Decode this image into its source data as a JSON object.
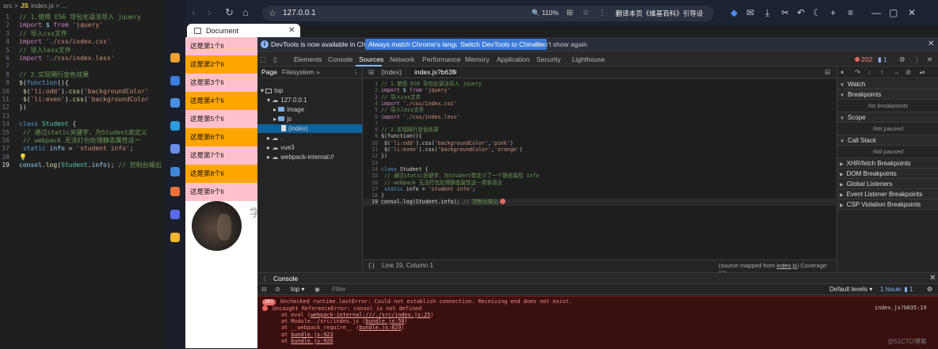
{
  "editor": {
    "breadcrumb": [
      "src",
      ">",
      "JS",
      "index.js",
      ">",
      "..."
    ],
    "lines": [
      {
        "n": "1",
        "parts": [
          [
            "com",
            "// 1.使用 ES6 导包化语法导入 jquery"
          ]
        ]
      },
      {
        "n": "2",
        "parts": [
          [
            "kw",
            "import "
          ],
          [
            "var",
            "$ "
          ],
          [
            "kw",
            "from "
          ],
          [
            "str",
            "'jquery'"
          ]
        ]
      },
      {
        "n": "3",
        "parts": [
          [
            "com",
            "// 导入css文件"
          ]
        ]
      },
      {
        "n": "4",
        "parts": [
          [
            "kw",
            "import "
          ],
          [
            "str",
            "'./css/index.css'"
          ]
        ]
      },
      {
        "n": "5",
        "parts": [
          [
            "com",
            "// 导入less文件"
          ]
        ]
      },
      {
        "n": "6",
        "parts": [
          [
            "kw",
            "import "
          ],
          [
            "str",
            "'./css/index.less'"
          ]
        ]
      },
      {
        "n": "7",
        "parts": []
      },
      {
        "n": "8",
        "parts": [
          [
            "com",
            "// 2.实现隔行变色效果"
          ]
        ]
      },
      {
        "n": "9",
        "parts": [
          [
            "fn",
            "$"
          ],
          [
            "txt",
            "("
          ],
          [
            "bl",
            "function"
          ],
          [
            "txt",
            "(){"
          ]
        ]
      },
      {
        "n": "10",
        "parts": [
          [
            "txt",
            "    "
          ],
          [
            "fn",
            "$"
          ],
          [
            "txt",
            "("
          ],
          [
            "str",
            "'li:odd'"
          ],
          [
            "txt",
            ")."
          ],
          [
            "fn",
            "css"
          ],
          [
            "txt",
            "("
          ],
          [
            "str",
            "'backgroundColor'"
          ]
        ]
      },
      {
        "n": "11",
        "parts": [
          [
            "txt",
            "    "
          ],
          [
            "fn",
            "$"
          ],
          [
            "txt",
            "("
          ],
          [
            "str",
            "'li:even'"
          ],
          [
            "txt",
            ")."
          ],
          [
            "fn",
            "css"
          ],
          [
            "txt",
            "("
          ],
          [
            "str",
            "'backgroundColor"
          ]
        ]
      },
      {
        "n": "12",
        "parts": [
          [
            "txt",
            "})"
          ]
        ]
      },
      {
        "n": "13",
        "parts": []
      },
      {
        "n": "14",
        "parts": [
          [
            "bl",
            "class "
          ],
          [
            "cls",
            "Student "
          ],
          [
            "txt",
            "{"
          ]
        ]
      },
      {
        "n": "15",
        "parts": [
          [
            "com",
            "    // 通过static关键字，为Student类定义"
          ]
        ]
      },
      {
        "n": "16",
        "parts": [
          [
            "com",
            "    // webpack 无法打包处理静态属性这一"
          ]
        ]
      },
      {
        "n": "17",
        "parts": [
          [
            "bl",
            "    static "
          ],
          [
            "var",
            "info "
          ],
          [
            "txt",
            "= "
          ],
          [
            "str",
            "'student info'"
          ],
          [
            "txt",
            ";"
          ]
        ]
      },
      {
        "n": "18",
        "parts": [
          [
            "txt",
            "💡"
          ]
        ]
      },
      {
        "n": "19",
        "parts": [
          [
            "var",
            "consol"
          ],
          [
            "txt",
            "."
          ],
          [
            "fn",
            "log"
          ],
          [
            "txt",
            "("
          ],
          [
            "cls",
            "Student"
          ],
          [
            "txt",
            "."
          ],
          [
            "var",
            "info"
          ],
          [
            "txt",
            "); "
          ],
          [
            "com",
            "// 控制台输出"
          ]
        ]
      }
    ]
  },
  "browser": {
    "url": "127.0.0.1",
    "zoom": "110%",
    "translate_label": "翻译本页《维基百科》引导设",
    "tab_title": "Document"
  },
  "page": {
    "list_items": [
      "这是第1个li",
      "这是第2个li",
      "这是第3个li",
      "这是第4个li",
      "这是第5个li",
      "这是第6个li",
      "这是第7个li",
      "这是第8个li",
      "这是第9个li"
    ],
    "odd_color": "#ffc0cb",
    "even_color": "#ffa500",
    "side_text": "学"
  },
  "devtools": {
    "info_message": "DevTools is now available in Chinese!",
    "btn_match": "Always match Chrome's language",
    "btn_switch": "Switch DevTools to Chinese",
    "dont_show": "Don't show again",
    "tabs": [
      "Elements",
      "Console",
      "Sources",
      "Network",
      "Performance",
      "Memory",
      "Application",
      "Security",
      "Lighthouse"
    ],
    "error_count": "202",
    "issue_count": "1",
    "nav_tabs": [
      "Page",
      "Filesystem",
      "»"
    ],
    "tree": {
      "top": "top",
      "host": "127.0.0.1",
      "image": "image",
      "js": "js",
      "index": "(index)",
      "dot": ".",
      "vue3": "vue3",
      "webpack": "webpack-internal://"
    },
    "editor_tabs": [
      "(index)",
      "index.js?b635"
    ],
    "source_lines": [
      {
        "n": "1",
        "parts": [
          [
            "com",
            "// 1.使用 ES6 导包化语法导入 jquery"
          ]
        ]
      },
      {
        "n": "2",
        "parts": [
          [
            "kw",
            "import "
          ],
          [
            "var",
            "$ "
          ],
          [
            "kw",
            "from "
          ],
          [
            "str",
            "'jquery'"
          ]
        ]
      },
      {
        "n": "3",
        "parts": [
          [
            "com",
            "// 导入css文件"
          ]
        ]
      },
      {
        "n": "4",
        "parts": [
          [
            "kw",
            "import "
          ],
          [
            "str",
            "'./css/index.css'"
          ]
        ]
      },
      {
        "n": "5",
        "parts": [
          [
            "com",
            "// 导入less文件"
          ]
        ]
      },
      {
        "n": "6",
        "parts": [
          [
            "kw",
            "import "
          ],
          [
            "str",
            "'./css/index.less'"
          ]
        ]
      },
      {
        "n": "7",
        "parts": []
      },
      {
        "n": "8",
        "parts": [
          [
            "com",
            "// 2.实现隔行变色效果"
          ]
        ]
      },
      {
        "n": "9",
        "parts": [
          [
            "txt",
            "$(function(){"
          ]
        ]
      },
      {
        "n": "10",
        "parts": [
          [
            "txt",
            "    $("
          ],
          [
            "str",
            "'li:odd'"
          ],
          [
            "txt",
            ").css("
          ],
          [
            "str",
            "'backgroundColor'"
          ],
          [
            "txt",
            ","
          ],
          [
            "str",
            "'pink'"
          ],
          [
            "txt",
            ")"
          ]
        ]
      },
      {
        "n": "11",
        "parts": [
          [
            "txt",
            "    $("
          ],
          [
            "str",
            "'li:even'"
          ],
          [
            "txt",
            ").css("
          ],
          [
            "str",
            "'backgroundColor'"
          ],
          [
            "txt",
            ","
          ],
          [
            "str",
            "'orange'"
          ],
          [
            "txt",
            ")"
          ]
        ]
      },
      {
        "n": "12",
        "parts": [
          [
            "txt",
            "})"
          ]
        ]
      },
      {
        "n": "13",
        "parts": []
      },
      {
        "n": "14",
        "parts": [
          [
            "bl",
            "class "
          ],
          [
            "txt",
            "Student {"
          ]
        ]
      },
      {
        "n": "15",
        "parts": [
          [
            "com",
            "    // 通过static关键字，为Student类定义了一个静态属性 info"
          ]
        ]
      },
      {
        "n": "16",
        "parts": [
          [
            "com",
            "    // webpack 无法打包处理静态属性这一类新语法"
          ]
        ]
      },
      {
        "n": "17",
        "parts": [
          [
            "bl",
            "    static "
          ],
          [
            "txt",
            "info = "
          ],
          [
            "str",
            "'student info'"
          ],
          [
            "txt",
            ";"
          ]
        ]
      },
      {
        "n": "18",
        "parts": [
          [
            "txt",
            "}"
          ]
        ]
      },
      {
        "n": "19",
        "parts": [
          [
            "txt",
            "consol.log(Student.info); "
          ],
          [
            "com",
            "// 控制台输出"
          ]
        ]
      }
    ],
    "status_pos": "Line 19, Column 1",
    "source_mapped": "(source mapped from ",
    "source_mapped_file": "index.js",
    "coverage": ") Coverage: n/a",
    "right_sections": [
      "Watch",
      "Breakpoints",
      "Scope",
      "Call Stack",
      "XHR/fetch Breakpoints",
      "DOM Breakpoints",
      "Global Listeners",
      "Event Listener Breakpoints",
      "CSP Violation Breakpoints"
    ],
    "no_breakpoints": "No breakpoints",
    "not_paused_1": "Not paused",
    "not_paused_2": "Not paused"
  },
  "console": {
    "title": "Console",
    "context": "top",
    "filter_placeholder": "Filter",
    "levels": "Default levels",
    "issues": "1 Issue: ",
    "issue_count": "1",
    "lines": [
      {
        "badge": "201",
        "text": "Unchecked runtime.lastError: Could not establish connection. Receiving end does not exist."
      },
      {
        "icon": true,
        "text": "Uncaught ReferenceError: consol is not defined",
        "right": "index.js?b635:19"
      },
      {
        "text": "at eval (",
        "link": "webpack-internal:///./src/index.js:25",
        "end": ")"
      },
      {
        "text": "at Module../src/index.js (",
        "link": "bundle.js:50",
        "end": ")"
      },
      {
        "text": "at __webpack_require__ (",
        "link": "bundle.js:829",
        "end": ")"
      },
      {
        "text": "at ",
        "link": "bundle.js:923",
        "end": ""
      },
      {
        "text": "at ",
        "link": "bundle.js:926",
        "end": ""
      }
    ]
  },
  "watermark": "@51CTO博客"
}
